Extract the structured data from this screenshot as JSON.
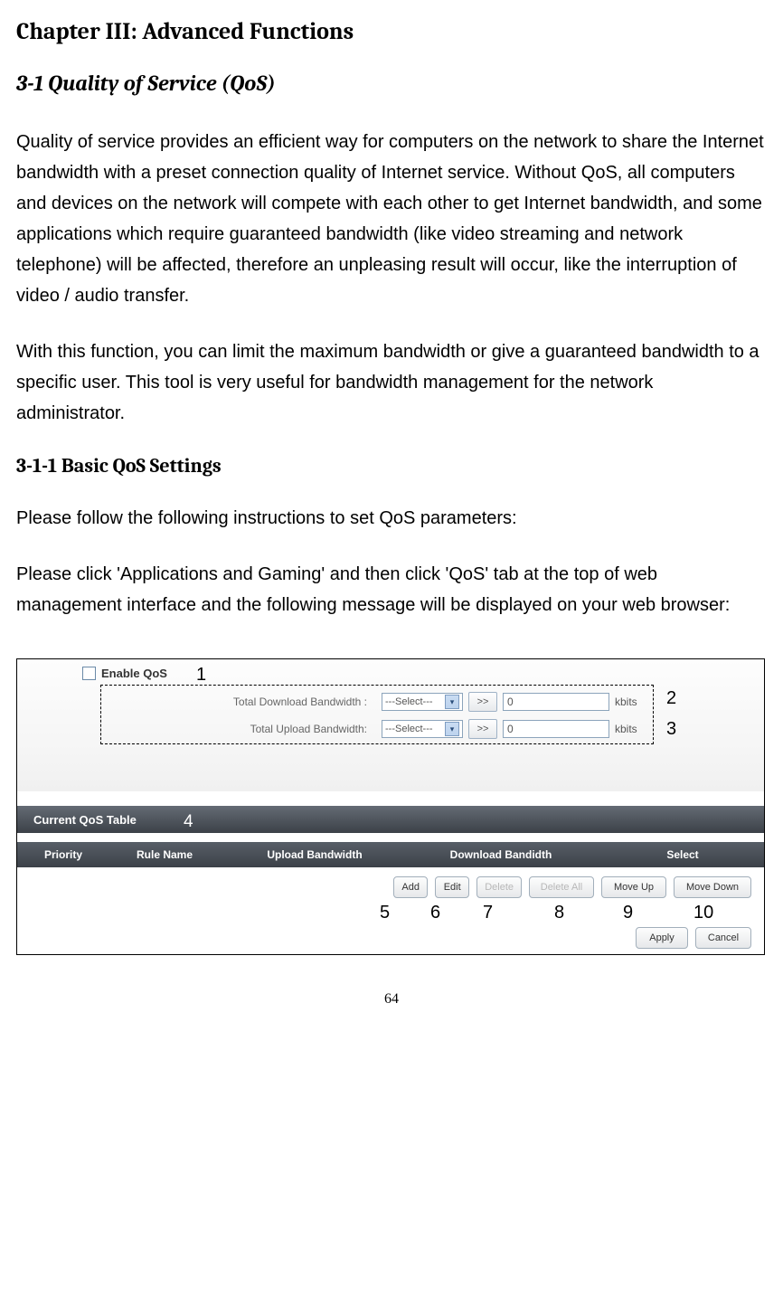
{
  "chapter_title": "Chapter III: Advanced Functions",
  "section_title": "3-1 Quality of Service (QoS)",
  "para1": "Quality of service provides an efficient way for computers on the network to share the Internet bandwidth with a preset connection quality of Internet service. Without QoS, all computers and devices on the network will compete with each other to get Internet bandwidth, and some applications which require guaranteed bandwidth (like video streaming and network telephone) will be affected, therefore an unpleasing result will occur, like the interruption of video / audio transfer.",
  "para2": "With this function, you can limit the maximum bandwidth or give a guaranteed bandwidth to a specific user.   This tool is very useful for bandwidth management for the network administrator.",
  "subsection_title": "3-1-1 Basic QoS Settings",
  "para3": "Please follow the following instructions to set QoS parameters:",
  "para4": "Please click 'Applications and Gaming' and then click 'QoS' tab at the top of web management interface and the following message will be displayed on your web browser:",
  "shot": {
    "enable_label": "Enable QoS",
    "dl_label": "Total Download Bandwidth :",
    "ul_label": "Total Upload Bandwidth:",
    "select_placeholder": "---Select---",
    "go": ">>",
    "val": "0",
    "unit": "kbits",
    "dark_title": "Current QoS Table",
    "hd": {
      "c1": "Priority",
      "c2": "Rule Name",
      "c3": "Upload Bandwidth",
      "c4": "Download Bandidth",
      "c5": "Select"
    },
    "btns": {
      "add": "Add",
      "edit": "Edit",
      "del": "Delete",
      "delall": "Delete All",
      "up": "Move Up",
      "down": "Move Down",
      "apply": "Apply",
      "cancel": "Cancel"
    }
  },
  "callouts": {
    "n1": "1",
    "n2": "2",
    "n3": "3",
    "n4": "4",
    "n5": "5",
    "n6": "6",
    "n7": "7",
    "n8": "8",
    "n9": "9",
    "n10": "10"
  },
  "page_number": "64"
}
